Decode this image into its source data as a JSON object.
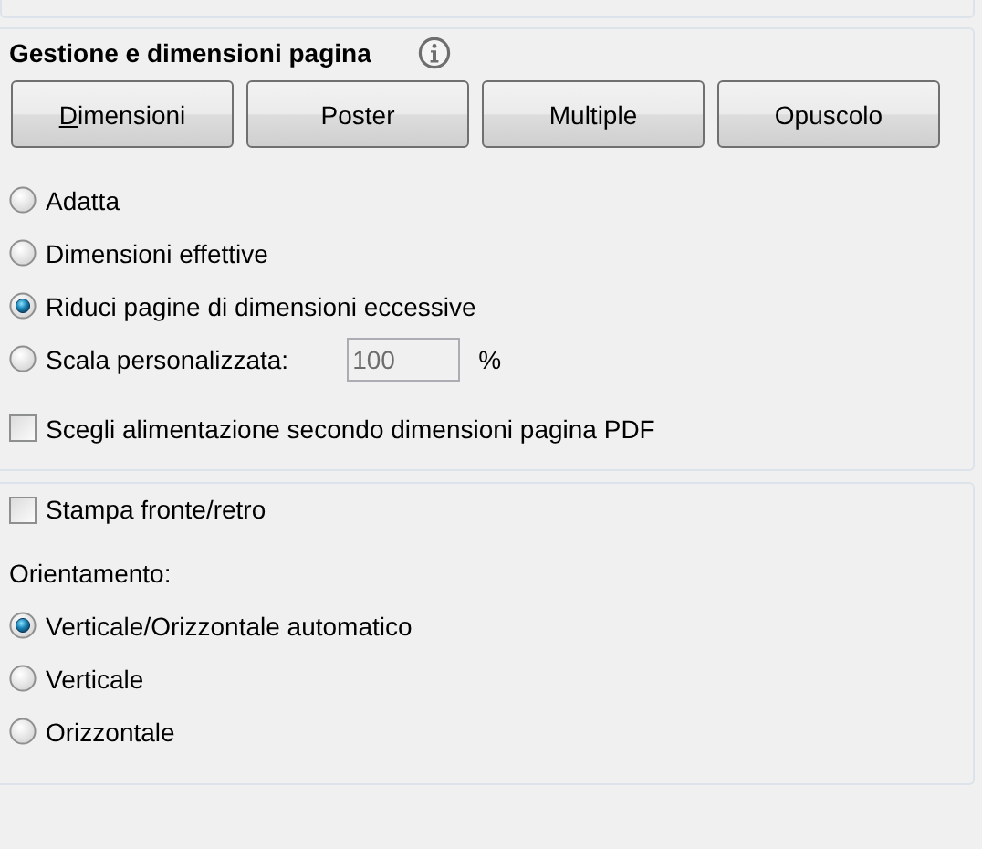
{
  "page_handling": {
    "title": "Gestione e dimensioni pagina",
    "modes": [
      {
        "label": "Dimensioni",
        "selected": false,
        "first_letter_underlined": true
      },
      {
        "label": "Poster",
        "selected": false
      },
      {
        "label": "Multiple",
        "selected": false
      },
      {
        "label": "Opuscolo",
        "selected": false
      }
    ],
    "options": [
      {
        "kind": "radio",
        "label": "Adatta",
        "selected": false
      },
      {
        "kind": "radio",
        "label": "Dimensioni effettive",
        "selected": false
      },
      {
        "kind": "radio",
        "label": "Riduci pagine di dimensioni eccessive",
        "selected": true
      },
      {
        "kind": "scale",
        "label": "Scala personalizzata:",
        "selected": false,
        "value": "100",
        "unit": "%",
        "disabled": true
      },
      {
        "kind": "checkbox",
        "label": "Scegli alimentazione secondo dimensioni pagina PDF",
        "checked": false
      }
    ]
  },
  "duplex": {
    "label": "Stampa fronte/retro",
    "checked": false
  },
  "orientation": {
    "label": "Orientamento:",
    "options": [
      {
        "label": "Verticale/Orizzontale automatico",
        "selected": true
      },
      {
        "label": "Verticale",
        "selected": false
      },
      {
        "label": "Orizzontale",
        "selected": false
      }
    ]
  }
}
